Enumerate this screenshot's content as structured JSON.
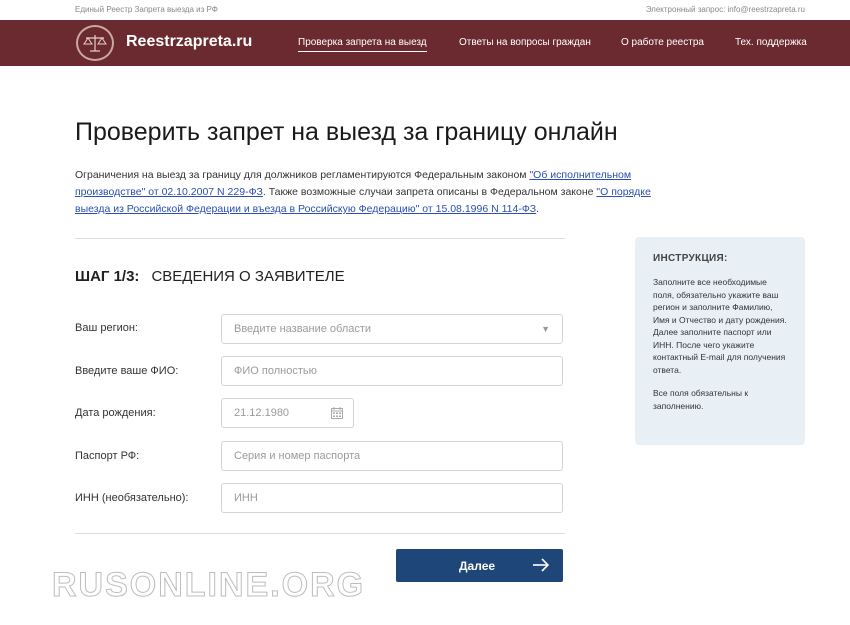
{
  "topbar": {
    "left_text": "Единый Реестр Запрета выезда из РФ",
    "right_text": "Электронный запрос: info@reestrzapreta.ru"
  },
  "header": {
    "brand": "Reestrzapreta.ru",
    "nav": [
      {
        "label": "Проверка запрета на выезд",
        "active": true
      },
      {
        "label": "Ответы на вопросы граждан",
        "active": false
      },
      {
        "label": "О работе реестра",
        "active": false
      },
      {
        "label": "Тех. поддержка",
        "active": false
      }
    ]
  },
  "main": {
    "title": "Проверить запрет на выезд за границу онлайн",
    "intro": {
      "part1": "Ограничения на выезд за границу для должников регламентируются Федеральным законом ",
      "link1": "\"Об исполнительном производстве\" от 02.10.2007 N 229-ФЗ",
      "part2": ". Также возможные случаи запрета описаны в Федеральном законе ",
      "link2": "\"О порядке выезда из Российской Федерации и въезда в Российскую Федерацию\" от 15.08.1996 N 114-ФЗ",
      "part3": "."
    },
    "step": {
      "number": "ШАГ 1/3:",
      "title": "СВЕДЕНИЯ О ЗАЯВИТЕЛЕ"
    },
    "form": {
      "region_label": "Ваш регион:",
      "region_placeholder": "Введите название области",
      "fio_label": "Введите ваше ФИО:",
      "fio_placeholder": "ФИО полностью",
      "birth_label": "Дата рождения:",
      "birth_value": "21.12.1980",
      "passport_label": "Паспорт РФ:",
      "passport_placeholder": "Серия и номер паспорта",
      "inn_label": "ИНН (необязательно):",
      "inn_placeholder": "ИНН",
      "next_label": "Далее"
    }
  },
  "instruction": {
    "title": "ИНСТРУКЦИЯ:",
    "text": "Заполните все необходимые поля, обязательно укажите ваш регион и заполните Фамилию, Имя и Отчество и дату рождения. Далее заполните паспорт или ИНН. После чего укажите контактный E-mail для получения ответа.",
    "text2": "Все поля обязательны к заполнению."
  },
  "watermark": "RUSONLINE.ORG",
  "colors": {
    "header_bg": "#6b2a2f",
    "button_bg": "#1f4678",
    "instruction_bg": "#e8f0f6",
    "link": "#2a4fb0"
  },
  "icons": {
    "logo": "scales-icon",
    "caret": "chevron-down-icon",
    "calendar": "calendar-icon",
    "arrow": "arrow-right-icon"
  }
}
